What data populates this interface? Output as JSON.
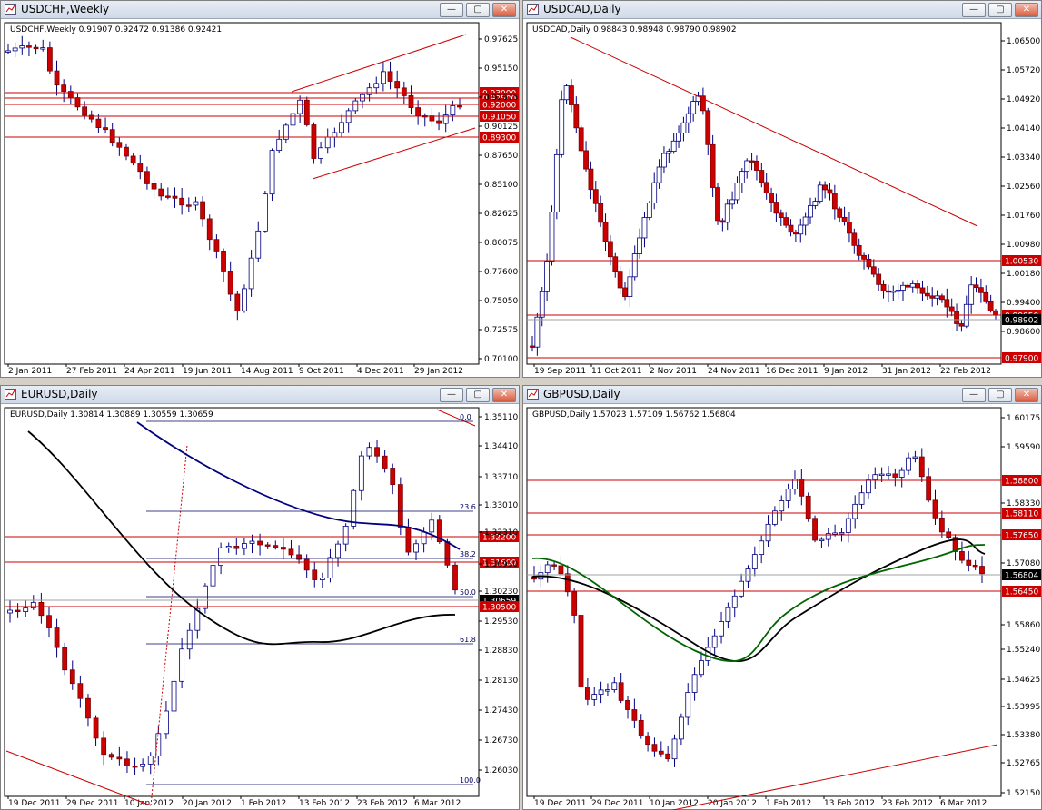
{
  "windows": [
    {
      "key": "usdchf",
      "title": "USDCHF,Weekly",
      "info": "USDCHF,Weekly  0.91907 0.92472 0.91386 0.92421",
      "prices": [
        "0.97625",
        "0.95150",
        "0.92675",
        "0.90125",
        "0.87650",
        "0.85100",
        "0.82625",
        "0.80075",
        "0.77600",
        "0.75050",
        "0.72575",
        "0.70100"
      ],
      "dates": [
        "2 Jan 2011",
        "27 Feb 2011",
        "24 Apr 2011",
        "19 Jun 2011",
        "14 Aug 2011",
        "9 Oct 2011",
        "4 Dec 2011",
        "29 Jan 2012"
      ],
      "hlines": [
        {
          "label": "0.93000",
          "red": true
        },
        {
          "label": "0.92500",
          "red": true
        },
        {
          "label": "0.92000",
          "red": true
        },
        {
          "label": "0.91050",
          "red": true
        },
        {
          "label": "0.89300",
          "red": true
        }
      ]
    },
    {
      "key": "usdcad",
      "title": "USDCAD,Daily",
      "info": "USDCAD,Daily  0.98843 0.98948 0.98790 0.98902",
      "prices": [
        "1.06500",
        "1.05720",
        "1.04920",
        "1.04140",
        "1.03340",
        "1.02560",
        "1.01760",
        "1.00980",
        "1.00180",
        "0.99400",
        "0.98600"
      ],
      "dates": [
        "19 Sep 2011",
        "11 Oct 2011",
        "2 Nov 2011",
        "24 Nov 2011",
        "16 Dec 2011",
        "9 Jan 2012",
        "31 Jan 2012",
        "22 Feb 2012"
      ],
      "hlines": [
        {
          "label": "1.00530",
          "red": true
        },
        {
          "label": "0.99050",
          "red": true
        },
        {
          "label": "0.98902",
          "red": false
        },
        {
          "label": "0.97900",
          "red": true
        }
      ]
    },
    {
      "key": "eurusd",
      "title": "EURUSD,Daily",
      "info": "EURUSD,Daily  1.30814 1.30889 1.30559 1.30659",
      "prices": [
        "1.35110",
        "1.34410",
        "1.33710",
        "1.33010",
        "1.32310",
        "1.30930",
        "1.30230",
        "1.29530",
        "1.28830",
        "1.28130",
        "1.27430",
        "1.26730",
        "1.26030"
      ],
      "dates": [
        "19 Dec 2011",
        "29 Dec 2011",
        "10 Jan 2012",
        "20 Jan 2012",
        "1 Feb 2012",
        "13 Feb 2012",
        "23 Feb 2012",
        "6 Mar 2012"
      ],
      "fib": [
        "0.0",
        "23.6",
        "38.2",
        "50.0",
        "61.8",
        "100.0"
      ],
      "hlines": [
        {
          "label": "1.32200",
          "red": true
        },
        {
          "label": "1.31600",
          "red": true
        },
        {
          "label": "1.30659",
          "red": false
        },
        {
          "label": "1.30500",
          "red": true
        }
      ]
    },
    {
      "key": "gbpusd",
      "title": "GBPUSD,Daily",
      "info": "GBPUSD,Daily  1.57023 1.57109 1.56762 1.56804",
      "prices": [
        "1.60175",
        "1.59590",
        "1.58330",
        "1.57080",
        "1.55860",
        "1.55240",
        "1.54625",
        "1.53995",
        "1.53380",
        "1.52765",
        "1.52150"
      ],
      "dates": [
        "19 Dec 2011",
        "29 Dec 2011",
        "10 Jan 2012",
        "20 Jan 2012",
        "1 Feb 2012",
        "13 Feb 2012",
        "23 Feb 2012",
        "6 Mar 2012"
      ],
      "hlines": [
        {
          "label": "1.58800",
          "red": true
        },
        {
          "label": "1.58110",
          "red": true
        },
        {
          "label": "1.57650",
          "red": true
        },
        {
          "label": "1.56804",
          "red": false
        },
        {
          "label": "1.56450",
          "red": true
        }
      ]
    }
  ],
  "controls": {
    "minimize": "—",
    "maximize": "▢",
    "close": "✕"
  },
  "colors": {
    "bull": "#ffffff",
    "bear": "#cc0000",
    "candle_edge": "#000080",
    "red_line": "#cc0000",
    "ma_black": "#000000",
    "ma_green": "#006400",
    "ma_navy": "#000080"
  }
}
